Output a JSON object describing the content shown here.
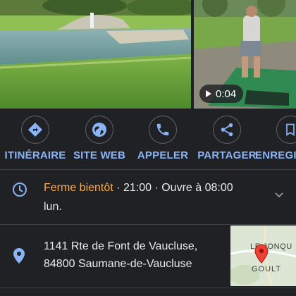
{
  "media": {
    "video_duration": "0:04"
  },
  "actions": [
    {
      "label": "ITINÉRAIRE",
      "icon": "directions-icon"
    },
    {
      "label": "SITE WEB",
      "icon": "globe-icon"
    },
    {
      "label": "APPELER",
      "icon": "phone-icon"
    },
    {
      "label": "PARTAGER",
      "icon": "share-icon"
    },
    {
      "label": "ENREGISTRER",
      "icon": "bookmark-icon"
    }
  ],
  "hours": {
    "status": "Ferme bientôt",
    "separator": "·",
    "closing_time": "21:00",
    "next_open": "Ouvre à 08:00",
    "next_open_day": "lun.",
    "status_color": "#f6a94c"
  },
  "address": {
    "street": "1141 Rte de Font de Vaucluse,",
    "city": "84800 Saumane-de-Vaucluse"
  },
  "minimap": {
    "label_top": "LE JONQU",
    "label_bottom": "GOULT"
  },
  "colors": {
    "accent": "#8ab4f8",
    "background": "#202124",
    "pin": "#ea4335"
  }
}
